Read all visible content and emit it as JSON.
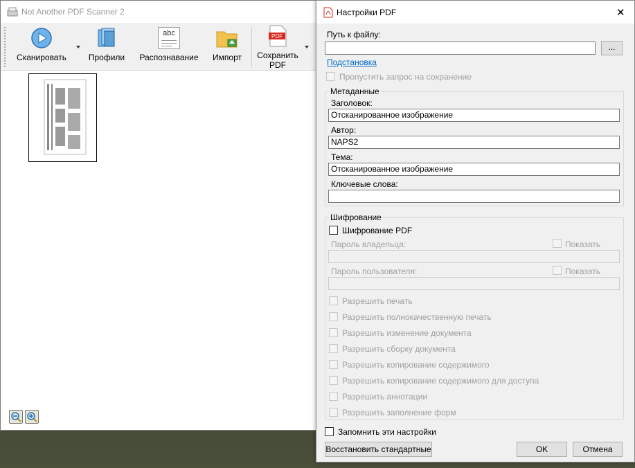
{
  "main_window": {
    "title": "Not Another PDF Scanner 2",
    "toolbar": {
      "scan_label": "Сканировать",
      "profiles_label": "Профили",
      "ocr_label": "Распознавание",
      "import_label": "Импорт",
      "save_pdf_label_line1": "Сохранить",
      "save_pdf_label_line2": "PDF",
      "pdf_icon_text": "PDF",
      "abc_icon_text": "abc"
    }
  },
  "dialog": {
    "title": "Настройки PDF",
    "close_glyph": "✕",
    "path_label": "Путь к файлу:",
    "path_value": "",
    "browse_label": "...",
    "placeholders_link": "Подстановка",
    "skip_prompt_label": "Пропустить запрос на сохранение",
    "metadata": {
      "group_title": "Метаданные",
      "title_label": "Заголовок:",
      "title_value": "Отсканированное изображение",
      "author_label": "Автор:",
      "author_value": "NAPS2",
      "subject_label": "Тема:",
      "subject_value": "Отсканированное изображение",
      "keywords_label": "Ключевые слова:",
      "keywords_value": ""
    },
    "encryption": {
      "group_title": "Шифрование",
      "encrypt_label": "Шифрование PDF",
      "owner_password_label": "Пароль владельца:",
      "user_password_label": "Пароль пользователя:",
      "show_label": "Показать",
      "permissions": [
        "Разрешить печать",
        "Разрешить полнокачественную печать",
        "Разрешить изменение документа",
        "Разрешить сборку документа",
        "Разрешить копирование содержимого",
        "Разрешить копирование содержимого для доступа",
        "Разрешить аннотации",
        "Разрешить заполнение форм"
      ]
    },
    "remember_label": "Запомнить эти настройки",
    "restore_defaults_label": "Восстановить стандартные",
    "ok_label": "OK",
    "cancel_label": "Отмена"
  }
}
